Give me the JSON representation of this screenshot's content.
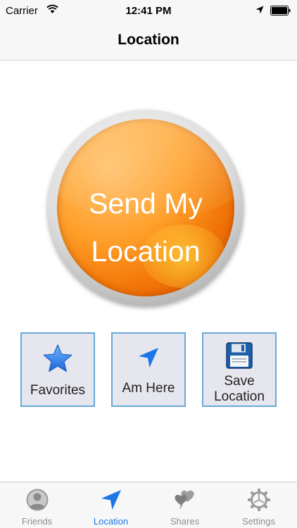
{
  "status_bar": {
    "carrier": "Carrier",
    "time": "12:41 PM"
  },
  "nav": {
    "title": "Location"
  },
  "main_button": {
    "line1": "Send My",
    "line2": "Location"
  },
  "actions": [
    {
      "label": "Favorites",
      "icon": "star-icon"
    },
    {
      "label": "Am Here",
      "icon": "location-arrow-icon"
    },
    {
      "label_line1": "Save",
      "label_line2": "Location",
      "icon": "floppy-disk-icon"
    }
  ],
  "tabs": [
    {
      "label": "Friends",
      "icon": "person-icon",
      "selected": false
    },
    {
      "label": "Location",
      "icon": "location-arrow-icon",
      "selected": true
    },
    {
      "label": "Shares",
      "icon": "hearts-icon",
      "selected": false
    },
    {
      "label": "Settings",
      "icon": "gear-icon",
      "selected": false
    }
  ],
  "colors": {
    "accent": "#1a78e6",
    "button_orange": "#ff9f2a",
    "action_border": "#69a9d7",
    "action_bg": "#e6e6ee"
  }
}
